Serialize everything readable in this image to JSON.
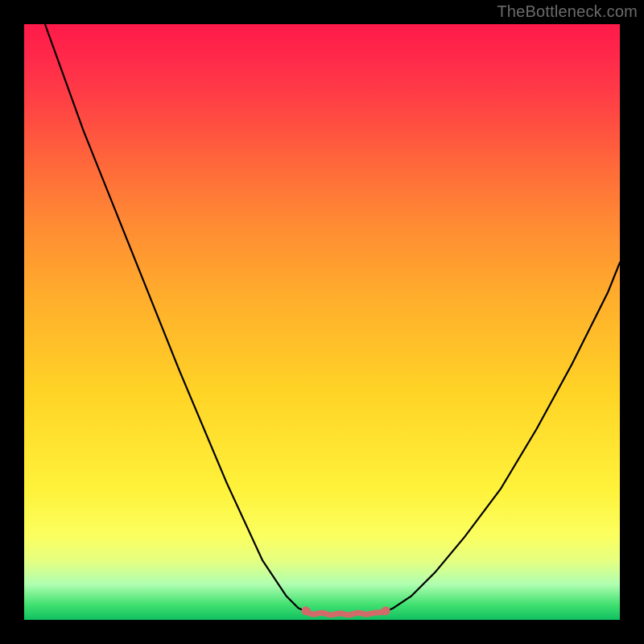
{
  "watermark_text": "TheBottleneck.com",
  "chart_data": {
    "type": "line",
    "title": "",
    "xlabel": "",
    "ylabel": "",
    "xlim": [
      0,
      100
    ],
    "ylim": [
      0,
      100
    ],
    "series": [
      {
        "name": "curve-left",
        "x": [
          3.5,
          10,
          18,
          26,
          34,
          40,
          44,
          46,
          47.5
        ],
        "y": [
          100,
          82,
          62,
          42,
          23,
          10,
          4,
          2,
          1.3
        ]
      },
      {
        "name": "curve-right",
        "x": [
          60.5,
          62,
          65,
          69,
          74,
          80,
          86,
          92,
          98,
          100
        ],
        "y": [
          1.3,
          2,
          4,
          8,
          14,
          22,
          32,
          43,
          55,
          60
        ]
      }
    ],
    "trough_segment": {
      "name": "trough-flat-bumpy",
      "color": "#d26a6a",
      "x": [
        47.5,
        48.5,
        50,
        51.5,
        53,
        54.5,
        56,
        57.5,
        59,
        60.5
      ],
      "y": [
        1.3,
        0.9,
        1.2,
        0.8,
        1.1,
        0.8,
        1.2,
        0.9,
        1.2,
        1.3
      ],
      "endpoint_markers_x": [
        47.3,
        60.7
      ],
      "endpoint_markers_y": [
        1.5,
        1.5
      ]
    }
  }
}
